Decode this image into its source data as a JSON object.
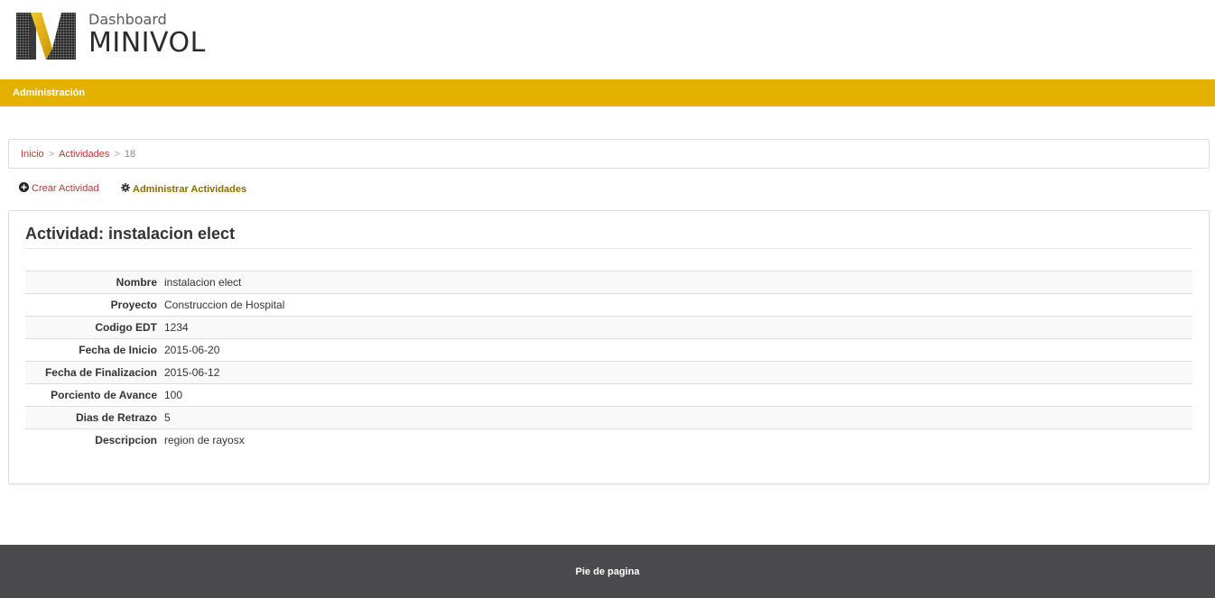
{
  "header": {
    "logo_letter_icon": "minivol-m-logo",
    "logo_subtitle": "Dashboard",
    "logo_title": "MINIVOL"
  },
  "nav": {
    "items": [
      {
        "label": "Administración"
      }
    ]
  },
  "breadcrumb": {
    "items": [
      {
        "label": "Inicio"
      },
      {
        "label": "Actividades"
      }
    ],
    "separator": ">",
    "current": "18"
  },
  "actions": {
    "create_icon": "plus-circle-icon",
    "create_label": "Crear Actividad",
    "admin_icon": "gear-icon",
    "admin_label": "Administrar Actividades"
  },
  "panel": {
    "title": "Actividad: instalacion elect",
    "rows": [
      {
        "label": "Nombre",
        "value": "instalacion elect"
      },
      {
        "label": "Proyecto",
        "value": "Construccion de Hospital"
      },
      {
        "label": "Codigo EDT",
        "value": "1234"
      },
      {
        "label": "Fecha de Inicio",
        "value": "2015-06-20"
      },
      {
        "label": "Fecha de Finalizacion",
        "value": "2015-06-12"
      },
      {
        "label": "Porciento de Avance",
        "value": "100"
      },
      {
        "label": "Dias de Retrazo",
        "value": "5"
      },
      {
        "label": "Descripcion",
        "value": "region de rayosx"
      }
    ]
  },
  "footer": {
    "text": "Pie de pagina"
  },
  "colors": {
    "brand_yellow": "#e4b100",
    "link_red": "#b03a3a",
    "footer_gray": "#4a4a4c"
  }
}
